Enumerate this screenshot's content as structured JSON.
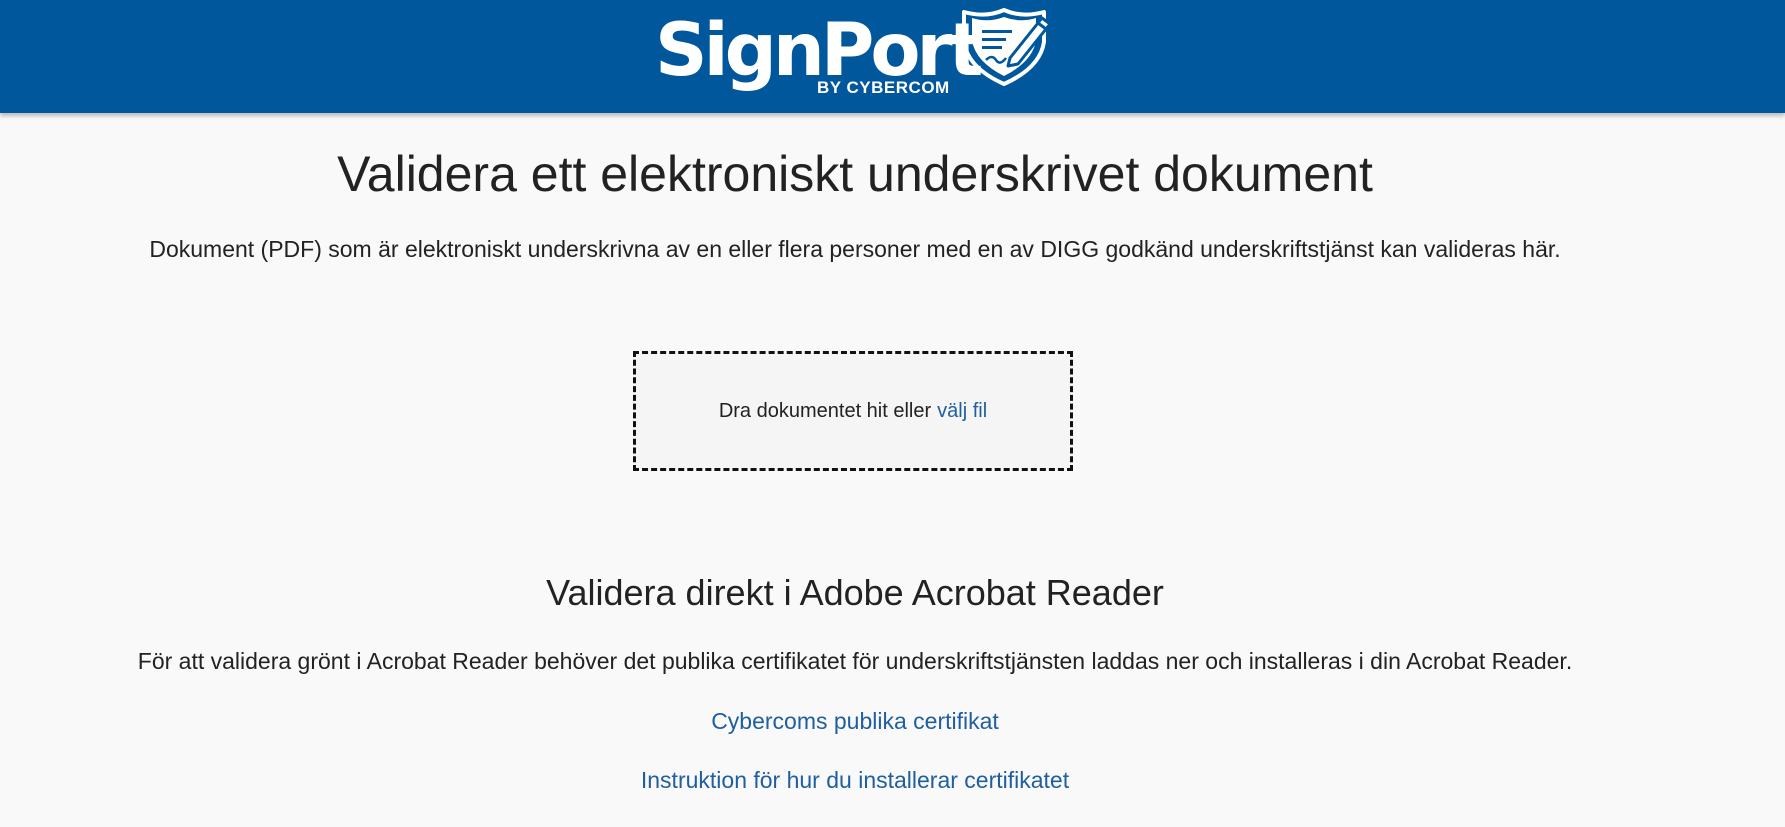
{
  "header": {
    "logo_text": "SignPort",
    "logo_subtext": "BY CYBERCOM",
    "background_color": "#00579c",
    "logo_icon": "shield-pen-icon"
  },
  "main": {
    "title": "Validera ett elektroniskt underskrivet dokument",
    "intro": "Dokument (PDF) som är elektroniskt underskrivna av en eller flera personer med en av DIGG godkänd underskriftstjänst kan valideras här.",
    "dropzone": {
      "text": "Dra dokumentet hit eller",
      "link_label": "välj fil"
    },
    "acrobat_section": {
      "title": "Validera direkt i Adobe Acrobat Reader",
      "text": "För att validera grönt i Acrobat Reader behöver det publika certifikatet för underskriftstjänsten laddas ner och installeras i din Acrobat Reader.",
      "links": [
        {
          "label": "Cybercoms publika certifikat"
        },
        {
          "label": "Instruktion för hur du installerar certifikatet"
        }
      ]
    },
    "link_color": "#1f5fa0"
  }
}
